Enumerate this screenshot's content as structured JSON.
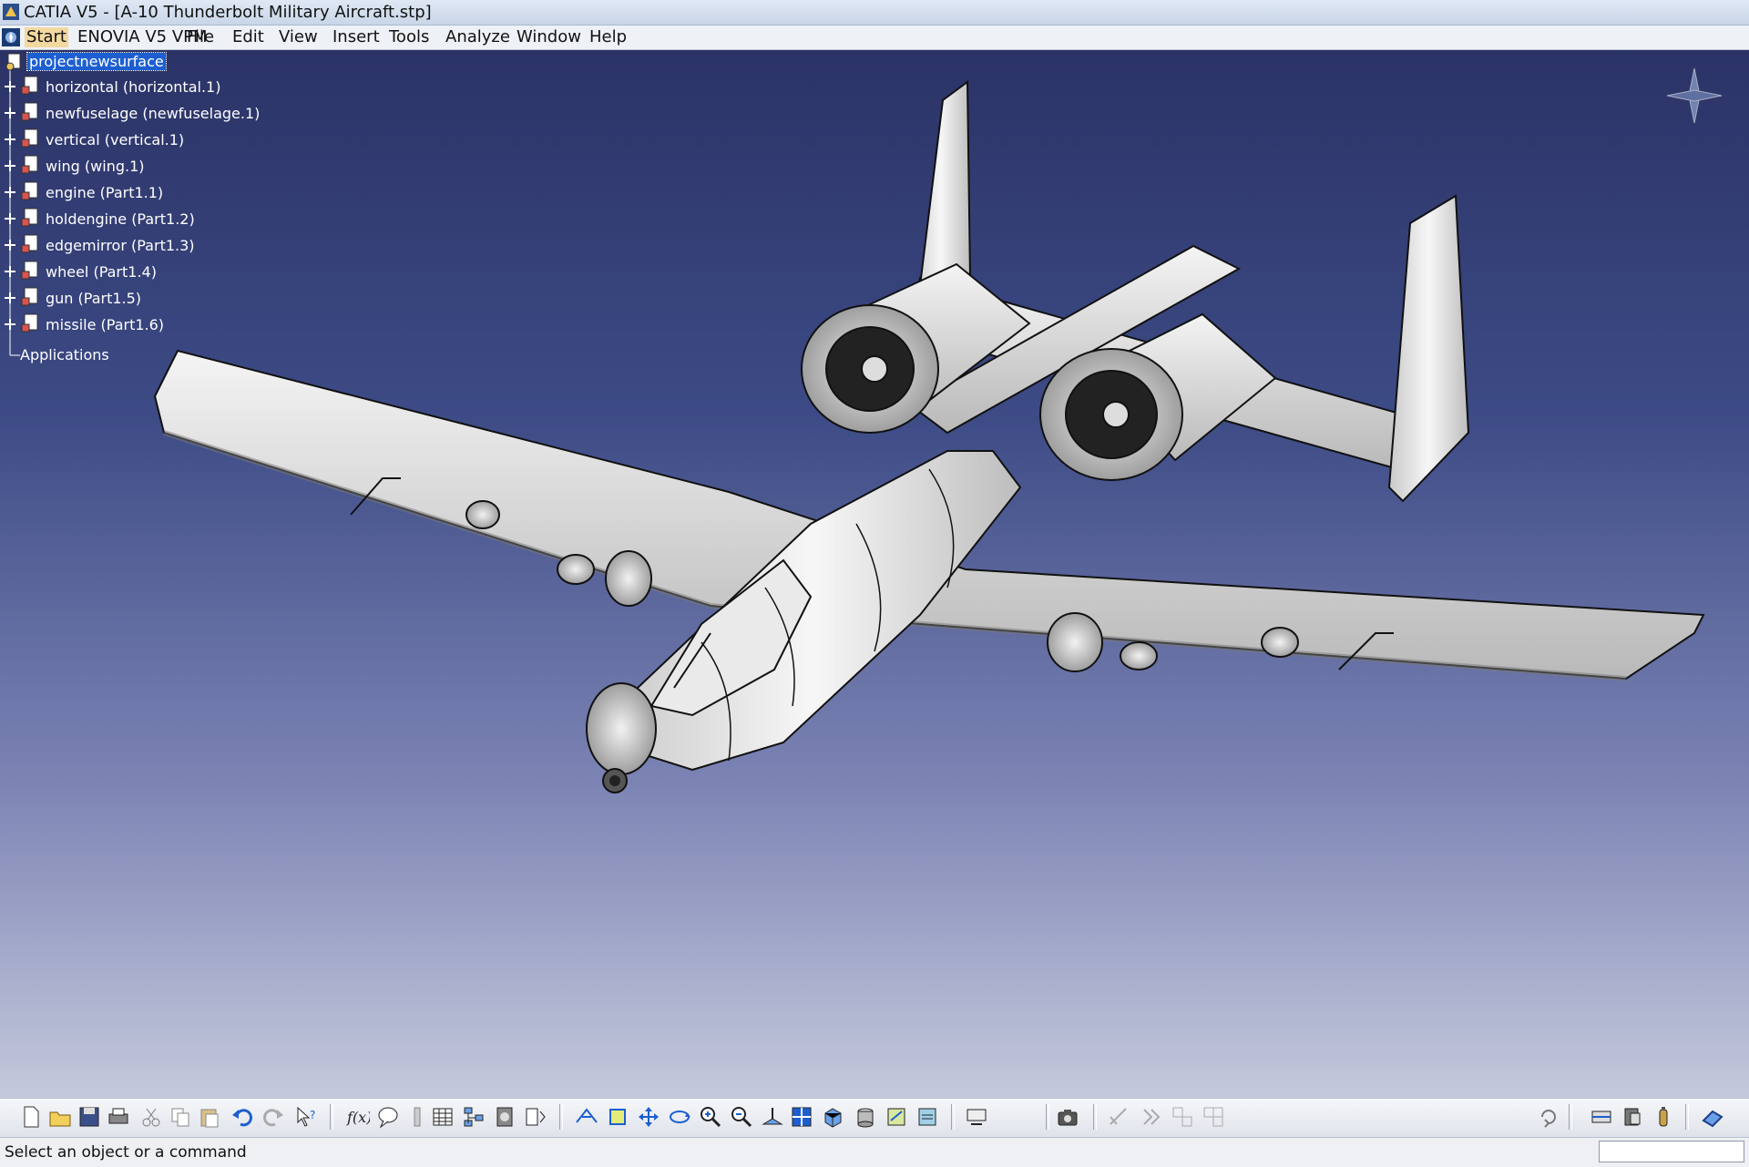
{
  "window": {
    "title": "CATIA V5 - [A-10 Thunderbolt Military Aircraft.stp]"
  },
  "menu": [
    "Start",
    "ENOVIA V5 VPM",
    "File",
    "Edit",
    "View",
    "Insert",
    "Tools",
    "Analyze",
    "Window",
    "Help"
  ],
  "tree": {
    "root": "projectnewsurface",
    "children": [
      "horizontal (horizontal.1)",
      "newfuselage (newfuselage.1)",
      "vertical (vertical.1)",
      "wing (wing.1)",
      "engine (Part1.1)",
      "holdengine (Part1.2)",
      "edgemirror (Part1.3)",
      "wheel (Part1.4)",
      "gun (Part1.5)",
      "missile (Part1.6)"
    ],
    "applications": "Applications"
  },
  "toolbar_icons": [
    "new-icon",
    "open-icon",
    "save-icon",
    "print-icon",
    "cut-icon",
    "copy-icon",
    "paste-icon",
    "undo-icon",
    "redo-icon",
    "whats-this-icon",
    "formula-icon",
    "comment-icon",
    "knowledge-icon",
    "table-icon",
    "tree-icon",
    "catalog-icon",
    "parameter-icon",
    "fly-mode-icon",
    "fit-all-icon",
    "pan-icon",
    "rotate-icon",
    "zoom-in-icon",
    "zoom-out-icon",
    "normal-view-icon",
    "multi-view-icon",
    "iso-view-icon",
    "shading-icon",
    "hide-show-icon",
    "swap-visible-icon",
    "graph-tree-icon",
    "capture-icon",
    "measure-icon",
    "analysis-icon",
    "constraint-icon",
    "constraint-edit-icon",
    "update-icon",
    "sketch-icon",
    "measure-between-icon",
    "material-icon",
    "apply-material-icon"
  ],
  "status": {
    "text": "Select an object or a command"
  },
  "colors": {
    "viewport_top": "#2b3366",
    "viewport_bottom": "#c5c9dc",
    "selection": "#1d5fd0",
    "menu_active": "#f3d9a0"
  }
}
